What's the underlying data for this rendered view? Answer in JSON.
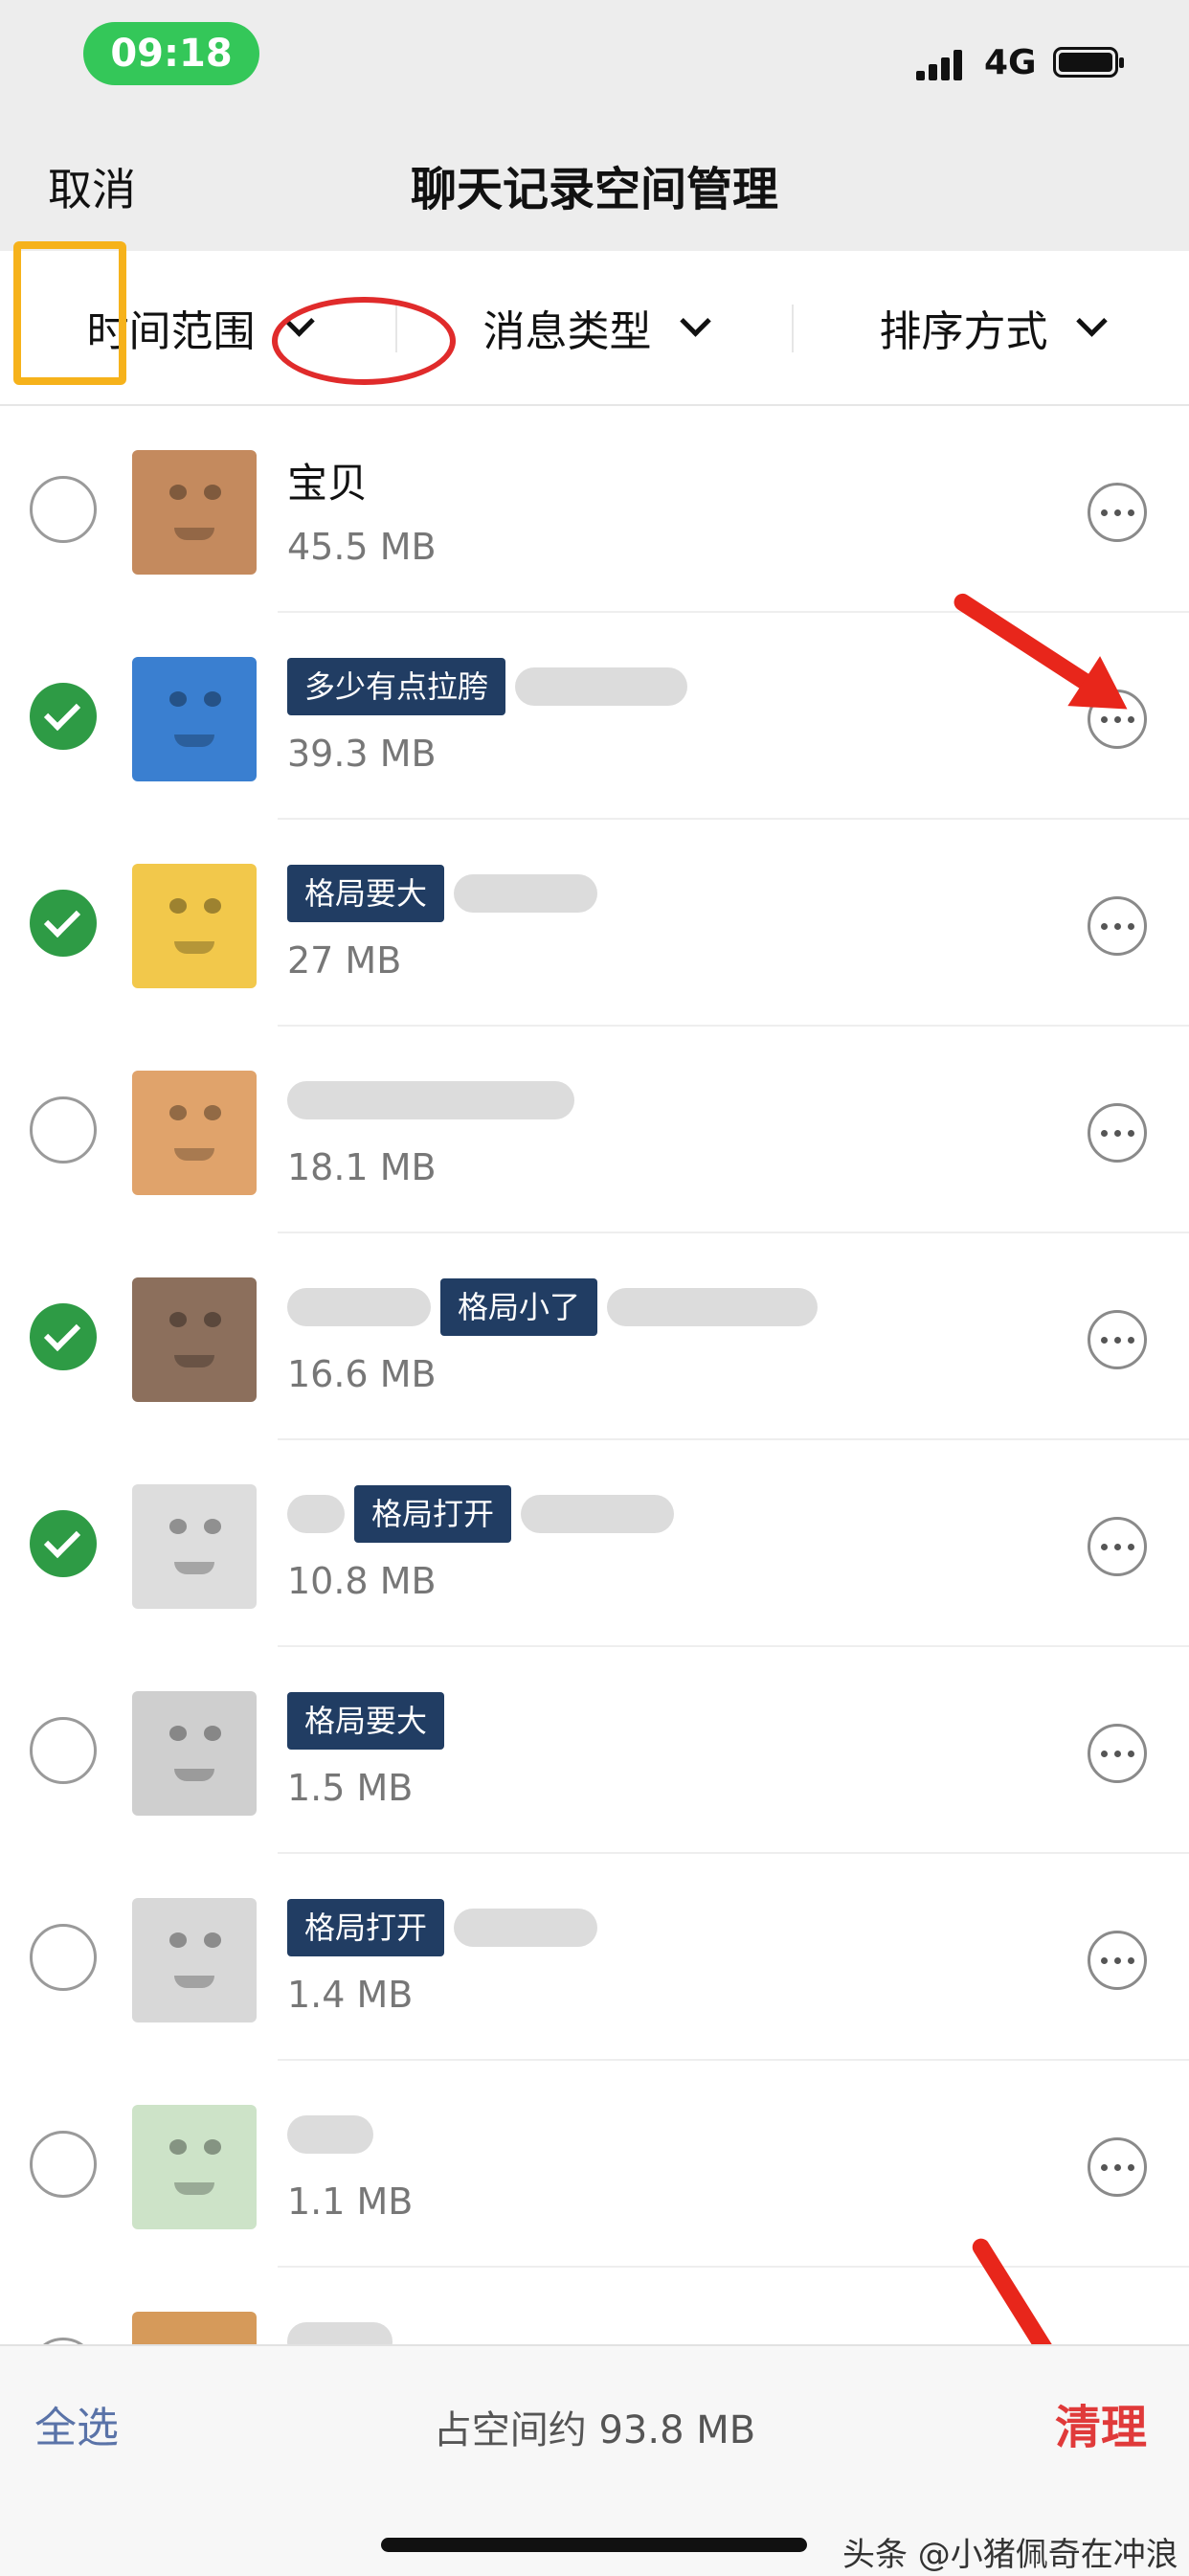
{
  "status_bar": {
    "time": "09:18",
    "network": "4G",
    "signal_icon": "signal-bars-icon",
    "battery_icon": "battery-full-icon"
  },
  "nav": {
    "cancel": "取消",
    "title": "聊天记录空间管理"
  },
  "filters": [
    {
      "label": "时间范围",
      "icon": "chevron-down-icon"
    },
    {
      "label": "消息类型",
      "icon": "chevron-down-icon"
    },
    {
      "label": "排序方式",
      "icon": "chevron-down-icon"
    }
  ],
  "rows": [
    {
      "name": "宝贝",
      "size": "45.5 MB",
      "checked": false,
      "avatar_color": "#c48a5e",
      "sticker": ""
    },
    {
      "name": "",
      "size": "39.3 MB",
      "checked": true,
      "avatar_color": "#3a7fd0",
      "sticker": "多少有点拉胯"
    },
    {
      "name": "",
      "size": "27 MB",
      "checked": true,
      "avatar_color": "#f2c84b",
      "sticker": "格局要大"
    },
    {
      "name": "",
      "size": "18.1 MB",
      "checked": false,
      "avatar_color": "#e0a36b",
      "sticker": ""
    },
    {
      "name": "",
      "size": "16.6 MB",
      "checked": true,
      "avatar_color": "#8c6f5c",
      "sticker": "格局小了"
    },
    {
      "name": "",
      "size": "10.8 MB",
      "checked": true,
      "avatar_color": "#dddddd",
      "sticker": "格局打开"
    },
    {
      "name": "",
      "size": "1.5 MB",
      "checked": false,
      "avatar_color": "#cfcfcf",
      "sticker": "格局要大"
    },
    {
      "name": "",
      "size": "1.4 MB",
      "checked": false,
      "avatar_color": "#d8d8d8",
      "sticker": "格局打开"
    },
    {
      "name": "",
      "size": "1.1 MB",
      "checked": false,
      "avatar_color": "#cde3c8",
      "sticker": ""
    },
    {
      "name": "",
      "size": "",
      "checked": false,
      "avatar_color": "#d69a5a",
      "sticker": ""
    }
  ],
  "row_more_icon": "more-circle-icon",
  "bottom": {
    "select_all": "全选",
    "space": "占空间约 93.8 MB",
    "clean": "清理"
  },
  "watermark": "头条 @小猪佩奇在冲浪",
  "colors": {
    "checked": "#2e9b45",
    "clean": "#e03a3a",
    "link": "#5a73a8",
    "highlight_box": "#f6b21b",
    "annotation_red": "#e8261b",
    "sticker_bg": "#213d63"
  }
}
